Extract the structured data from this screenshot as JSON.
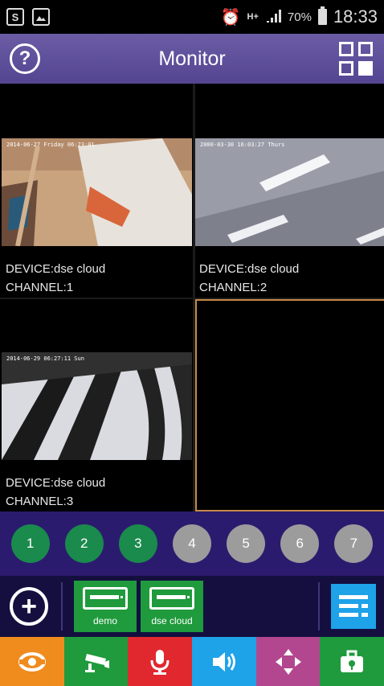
{
  "status_bar": {
    "left_icons": [
      "skype-icon",
      "gallery-icon"
    ],
    "network": "H+",
    "battery": "70%",
    "time": "18:33"
  },
  "header": {
    "help_icon": "?",
    "title": "Monitor",
    "layout_icon": "grid-layout-icon"
  },
  "cameras": [
    {
      "osd": "2014-06-27 Friday 06:23:01",
      "device": "DEVICE:dse cloud",
      "channel": "CHANNEL:1"
    },
    {
      "osd": "2000-03-30 16:03:27 Thurs",
      "device": "DEVICE:dse cloud",
      "channel": "CHANNEL:2"
    },
    {
      "osd": "2014-06-29 06:27:11 Sun",
      "device": "DEVICE:dse cloud",
      "channel": "CHANNEL:3"
    },
    {
      "osd": "",
      "device": "",
      "channel": ""
    }
  ],
  "channels": [
    {
      "label": "1",
      "active": true
    },
    {
      "label": "2",
      "active": true
    },
    {
      "label": "3",
      "active": true
    },
    {
      "label": "4",
      "active": false
    },
    {
      "label": "5",
      "active": false
    },
    {
      "label": "6",
      "active": false
    },
    {
      "label": "7",
      "active": false
    }
  ],
  "devices": [
    {
      "name": "demo"
    },
    {
      "name": "dse cloud"
    }
  ],
  "tools": [
    {
      "icon": "ptz-icon",
      "color": "#f08c1e"
    },
    {
      "icon": "record-camera-icon",
      "color": "#1f9a3c"
    },
    {
      "icon": "microphone-icon",
      "color": "#e0282e"
    },
    {
      "icon": "speaker-icon",
      "color": "#1ea2e8"
    },
    {
      "icon": "direction-arrows-icon",
      "color": "#b2478f"
    },
    {
      "icon": "toolbox-icon",
      "color": "#1f9a3c"
    }
  ],
  "colors": {
    "header": "#5c4c9c",
    "channel_bar": "#2b1b6e",
    "active_channel": "#1a8a4d",
    "inactive_channel": "#9c9c9c",
    "selected_cell_border": "#c58a4a"
  }
}
